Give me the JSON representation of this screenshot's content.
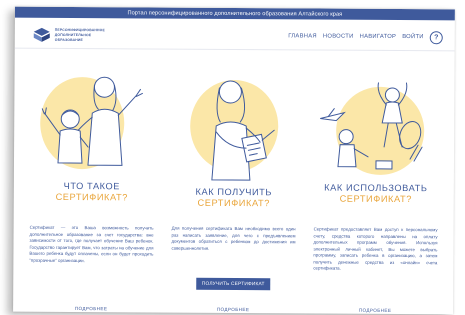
{
  "banner": {
    "text": "Портал персонифицированного дополнительного образования Алтайского края"
  },
  "logo": {
    "lines": [
      "ПЕРСОНИФИЦИРОВАННОЕ",
      "ДОПОЛНИТЕЛЬНОЕ",
      "ОБРАЗОВАНИЕ"
    ],
    "brand_color": "#3f5a9c"
  },
  "nav": {
    "items": [
      "ГЛАВНАЯ",
      "НОВОСТИ",
      "НАВИГАТОР",
      "ВОЙТИ"
    ],
    "help": "?"
  },
  "columns": [
    {
      "title_main": "ЧТО ТАКОЕ",
      "title_accent": "СЕРТИФИКАТ?",
      "text": "Сертификат — это Ваша возможность получить дополнительное образование за счет государства: вне зависимости от того, где получает обучение Ваш ребенок. Государство гарантирует Вам, что затраты на обучение для Вашего ребенка будут оплачены, если он будет проходить \"прозрачные\" организации.",
      "more": "ПОДРОБНЕЕ"
    },
    {
      "title_main": "КАК ПОЛУЧИТЬ",
      "title_accent": "СЕРТИФИКАТ?",
      "text": "Для получения сертификата Вам необходимо всего один раз написать заявление, для чего с предъявлением документов обратиться с ребенком до достижения им совершеннолетия.",
      "button": "ПОЛУЧИТЬ СЕРТИФИКАТ",
      "more": "ПОДРОБНЕЕ"
    },
    {
      "title_main": "КАК ИСПОЛЬЗОВАТЬ",
      "title_accent": "СЕРТИФИКАТ?",
      "text": "Сертификат предоставляет Вам доступ к персональному счету, средства которого направлены на оплату дополнительных программ обучения. Используя электронный личный кабинет, Вы можете выбрать программу, записать ребенка в организацию, а затем получить денежные средства из «онлайн» счета сертификата.",
      "more": "ПОДРОБНЕЕ"
    }
  ],
  "colors": {
    "primary": "#3f5a9c",
    "accent": "#e9a53a",
    "illustration_blob": "#fbe7a8"
  }
}
